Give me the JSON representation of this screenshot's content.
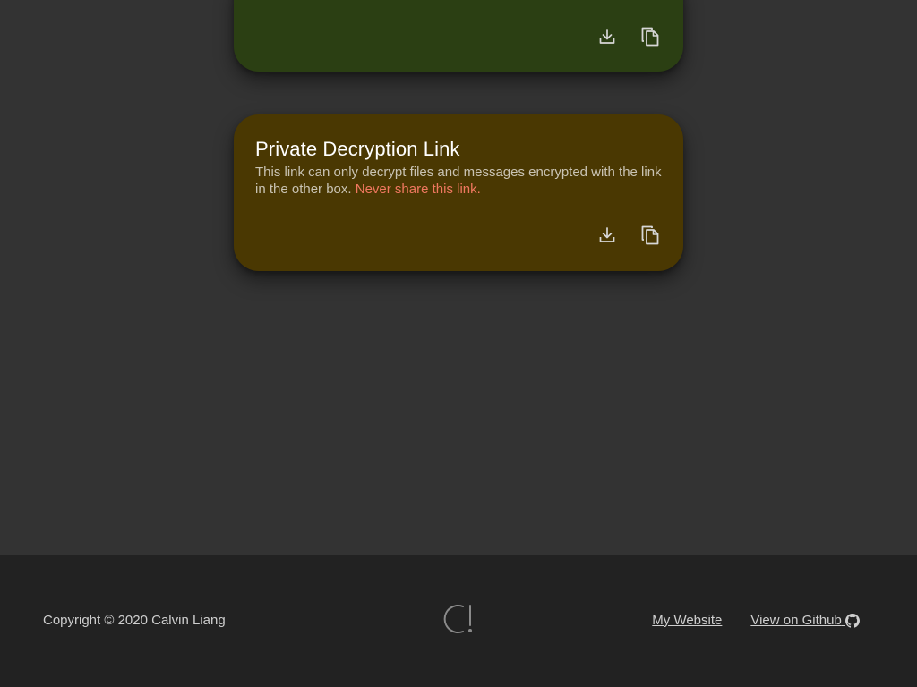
{
  "cards": {
    "public": {
      "color": "#2b3f13",
      "actions": {
        "download_icon": "download-icon",
        "copy_icon": "copy-icon"
      }
    },
    "private": {
      "color": "#4a3802",
      "title": "Private Decryption Link",
      "description": "This link can only decrypt files and messages encrypted with the link in the other box.",
      "warning": "Never share this link.",
      "warning_color": "#f07860",
      "actions": {
        "download_icon": "download-icon",
        "copy_icon": "copy-icon"
      }
    }
  },
  "footer": {
    "copyright": "Copyright © 2020 Calvin Liang",
    "logo_icon": "logo-icon",
    "links": [
      {
        "label": "My Website"
      },
      {
        "label": "View on Github",
        "icon": "github-icon"
      }
    ]
  }
}
